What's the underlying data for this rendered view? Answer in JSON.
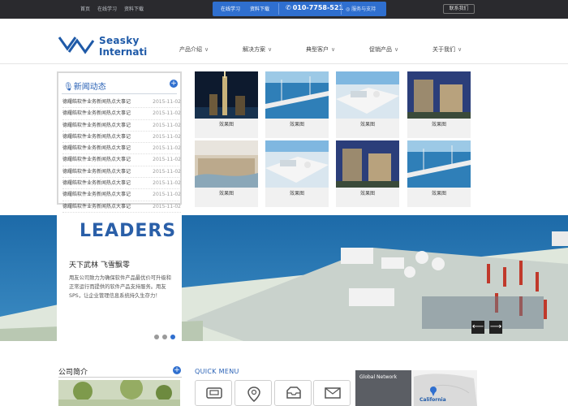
{
  "topbar": {
    "links": [
      "首页",
      "在线学习",
      "资料下载"
    ],
    "tab_learn": "在线学习",
    "tab_download": "资料下载",
    "phone": "010-7758-521",
    "note": "服务与支持",
    "contact": "联系我们"
  },
  "brand": {
    "line1": "Seasky",
    "line2": "Internati"
  },
  "nav": [
    "产品介绍",
    "解决方案",
    "典型客户",
    "促销产品",
    "关于我们"
  ],
  "news": {
    "title": "新闻动态",
    "items": [
      {
        "text": "德耀皓软件业务新闻热点大事记",
        "date": "2015-11-02"
      },
      {
        "text": "德耀皓软件业务新闻热点大事记",
        "date": "2015-11-02"
      },
      {
        "text": "德耀皓软件业务新闻热点大事记",
        "date": "2015-11-02"
      },
      {
        "text": "德耀皓软件业务新闻热点大事记",
        "date": "2015-11-02"
      },
      {
        "text": "德耀皓软件业务新闻热点大事记",
        "date": "2015-11-02"
      },
      {
        "text": "德耀皓软件业务新闻热点大事记",
        "date": "2015-11-02"
      },
      {
        "text": "德耀皓软件业务新闻热点大事记",
        "date": "2015-11-02"
      },
      {
        "text": "德耀皓软件业务新闻热点大事记",
        "date": "2015-11-02"
      },
      {
        "text": "德耀皓软件业务新闻热点大事记",
        "date": "2015-11-02"
      },
      {
        "text": "德耀皓软件业务新闻热点大事记",
        "date": "2015-11-02"
      }
    ]
  },
  "products": [
    {
      "caption": "效果图"
    },
    {
      "caption": "效果图"
    },
    {
      "caption": "效果图"
    },
    {
      "caption": "效果图"
    },
    {
      "caption": "效果图"
    },
    {
      "caption": "效果图"
    },
    {
      "caption": "效果图"
    },
    {
      "caption": "效果图"
    }
  ],
  "banner": {
    "title": "LEADERS",
    "subtitle": "天下武林 飞雪飘零",
    "body": "用友公司致力为确保软件产品最优价可升级和正常运行而提供的软件产品支持服务。用友SPS，让企业管理信息系统持久生存力！",
    "active_slide": 3,
    "slide_count": 3
  },
  "about": {
    "title": "公司简介"
  },
  "quick_menu": {
    "title": "QUICK MENU"
  },
  "map": {
    "title": "Global Network",
    "pin_label": "California"
  }
}
